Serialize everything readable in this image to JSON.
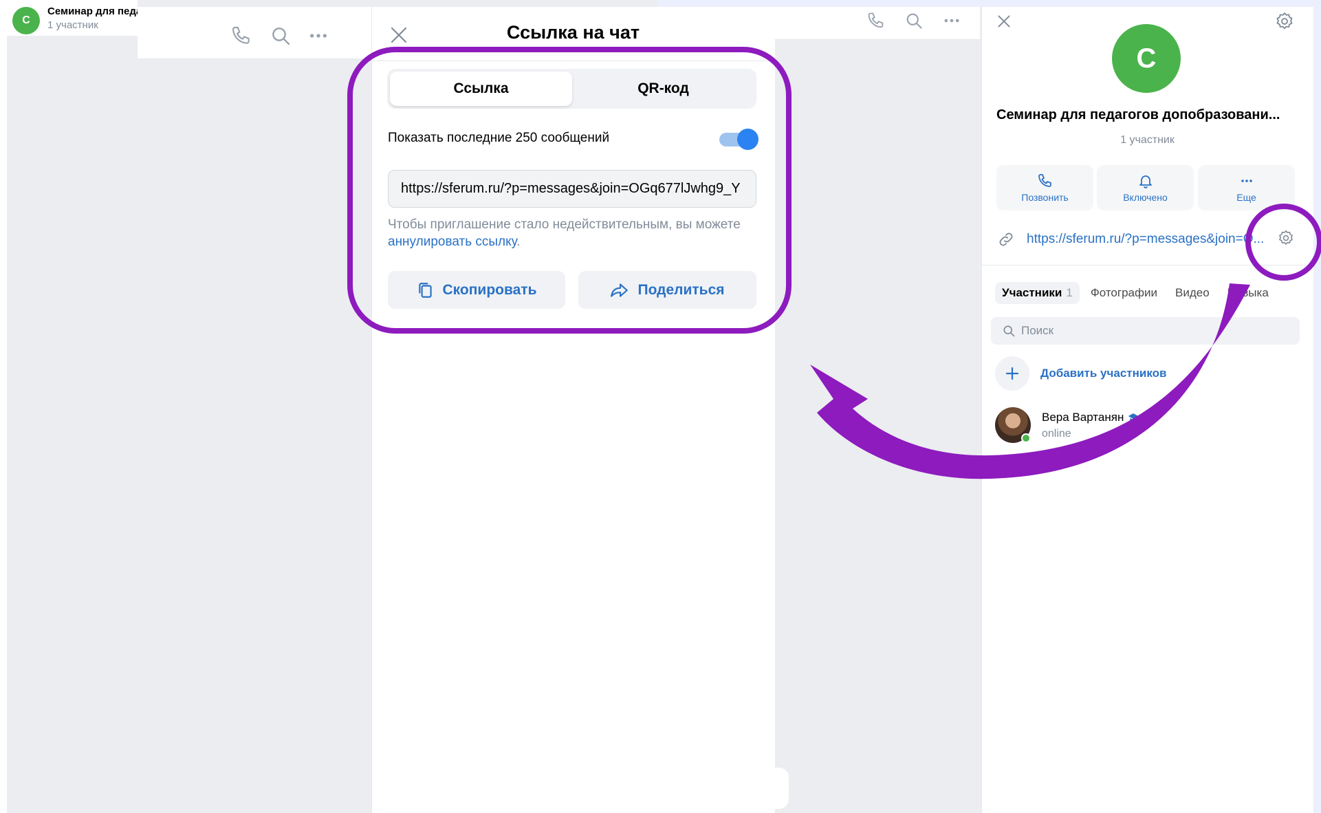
{
  "chat_header": {
    "avatar_letter": "С",
    "title": "Семинар для педагогов допобразования",
    "subtitle": "1 участник"
  },
  "modal": {
    "title": "Ссылка на чат",
    "tabs": {
      "link": "Ссылка",
      "qr": "QR-код"
    },
    "toggle_label": "Показать последние 250 сообщений",
    "toggle_on": true,
    "link_value": "https://sferum.ru/?p=messages&join=OGq677lJwhg9_Y",
    "hint_text": "Чтобы приглашение стало недействительным, вы можете ",
    "hint_link": "аннулировать ссылку",
    "hint_end": ".",
    "copy_label": "Скопировать",
    "share_label": "Поделиться"
  },
  "panel": {
    "avatar_letter": "С",
    "title": "Семинар для педагогов допобразовани...",
    "subtitle": "1 участник",
    "actions": {
      "call": "Позвонить",
      "notify": "Включено",
      "more": "Еще"
    },
    "link": "https://sferum.ru/?p=messages&join=O...",
    "tabs": {
      "members": "Участники",
      "members_count": "1",
      "photos": "Фотографии",
      "video": "Видео",
      "music": "Музыка"
    },
    "search_placeholder": "Поиск",
    "add_members": "Добавить участников",
    "member": {
      "name": "Вера Вартанян",
      "status": "online"
    }
  },
  "colors": {
    "accent": "#2a71c4",
    "toggle": "#2a83f0",
    "avatar_green": "#4bb34b",
    "highlight_purple": "#8d1bbe",
    "background": "#ebedf0"
  },
  "icons": [
    "phone-icon",
    "search-icon",
    "more-icon",
    "close-icon",
    "copy-icon",
    "share-icon",
    "bell-icon",
    "link-icon",
    "gear-icon",
    "plus-icon",
    "graduation-cap-icon",
    "star-icon"
  ]
}
